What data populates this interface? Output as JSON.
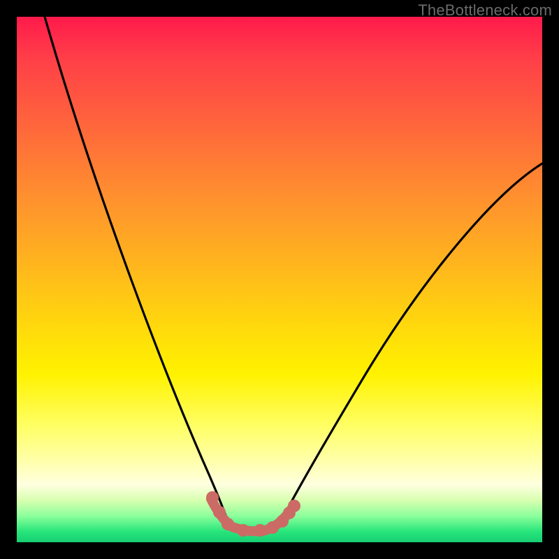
{
  "watermark": "TheBottleneck.com",
  "chart_data": {
    "type": "line",
    "title": "",
    "xlabel": "",
    "ylabel": "",
    "xlim": [
      0,
      100
    ],
    "ylim": [
      0,
      100
    ],
    "grid": false,
    "legend": false,
    "series": [
      {
        "name": "left-branch",
        "x": [
          0,
          4,
          8,
          12,
          16,
          20,
          24,
          28,
          30,
          32,
          34,
          36,
          37,
          38,
          39,
          40
        ],
        "values": [
          100,
          90,
          80,
          70,
          60,
          50,
          40,
          30,
          24,
          18,
          13,
          9,
          7,
          5,
          4,
          3
        ]
      },
      {
        "name": "right-branch",
        "x": [
          50,
          52,
          55,
          58,
          62,
          66,
          70,
          75,
          80,
          85,
          90,
          95,
          100
        ],
        "values": [
          3,
          5,
          9,
          13,
          18,
          24,
          30,
          36,
          43,
          50,
          57,
          64,
          72
        ]
      },
      {
        "name": "bottom-flat",
        "x": [
          40,
          42,
          44,
          46,
          48,
          50
        ],
        "values": [
          3,
          2.5,
          2.5,
          2.5,
          2.5,
          3
        ]
      }
    ],
    "markers": {
      "name": "bottleneck-points",
      "color": "#cc6a66",
      "x": [
        37,
        38.5,
        40,
        43,
        46,
        48.5,
        50,
        51,
        52
      ],
      "values": [
        8,
        5.5,
        3,
        2.5,
        2.5,
        2.5,
        3,
        4.5,
        6
      ]
    },
    "background_gradient": {
      "top": "#ff1a4b",
      "mid": "#ffff00",
      "bottom": "#17cf74"
    }
  }
}
